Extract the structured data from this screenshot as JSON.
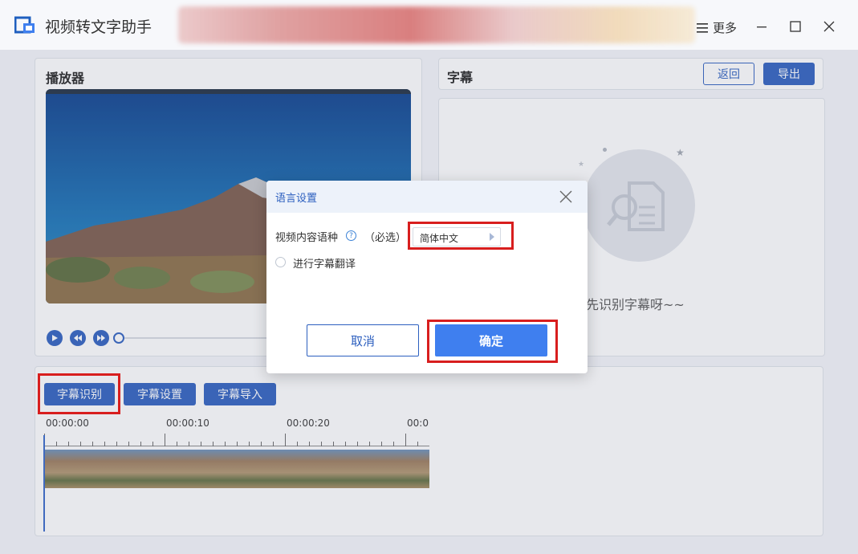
{
  "titlebar": {
    "app_title": "视频转文字助手",
    "more_label": "更多"
  },
  "player": {
    "title": "播放器"
  },
  "subtitle_panel": {
    "title": "字幕",
    "back_label": "返回",
    "export_label": "导出",
    "hint": "先识别字幕呀~~"
  },
  "toolbar": {
    "recognize_label": "字幕识别",
    "settings_label": "字幕设置",
    "import_label": "字幕导入"
  },
  "timeline": {
    "labels": [
      "00:00:00",
      "00:00:10",
      "00:00:20",
      "00:0("
    ]
  },
  "dialog": {
    "title": "语言设置",
    "field_label": "视频内容语种",
    "help": "?",
    "required": "（必选）",
    "language_value": "简体中文",
    "translate_label": "进行字幕翻译",
    "cancel_label": "取消",
    "ok_label": "确定"
  },
  "colors": {
    "accent": "#2c5fbf",
    "ok_button": "#3f7fef",
    "highlight": "#d81e1e"
  }
}
